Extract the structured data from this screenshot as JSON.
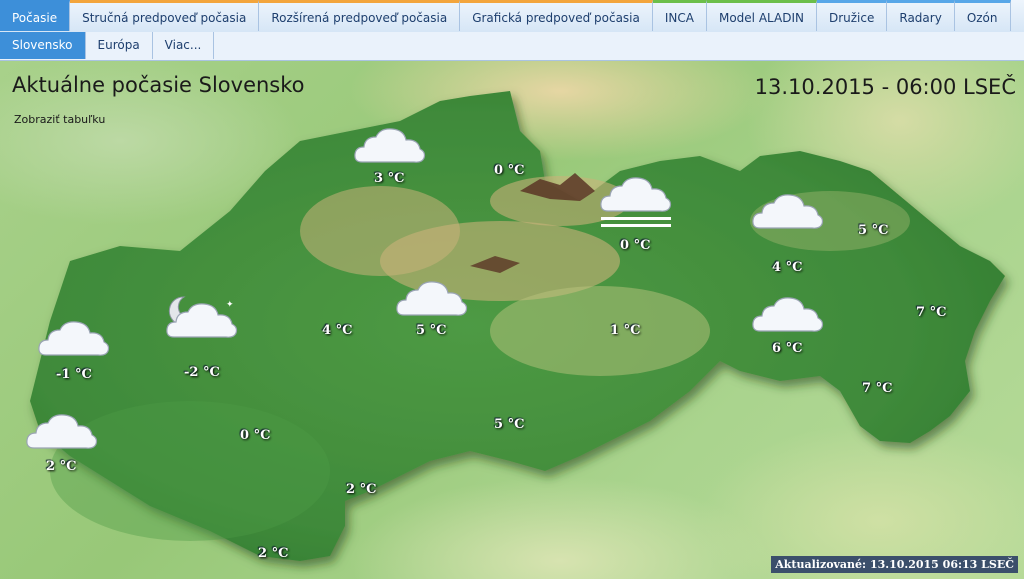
{
  "nav": {
    "tabs": [
      {
        "label": "Počasie"
      },
      {
        "label": "Stručná predpoveď počasia"
      },
      {
        "label": "Rozšírená predpoveď počasia"
      },
      {
        "label": "Grafická predpoveď počasia"
      },
      {
        "label": "INCA"
      },
      {
        "label": "Model ALADIN"
      },
      {
        "label": "Družice"
      },
      {
        "label": "Radary"
      },
      {
        "label": "Ozón"
      }
    ],
    "subtabs": [
      {
        "label": "Slovensko"
      },
      {
        "label": "Európa"
      },
      {
        "label": "Viac..."
      }
    ]
  },
  "map": {
    "title": "Aktuálne počasie Slovensko",
    "show_table": "Zobraziť tabuľku",
    "datetime": "13.10.2015 - 06:00 LSEČ",
    "updated": "Aktualizované: 13.10.2015 06:13 LSEČ",
    "colors": {
      "land": "#3f8a3a",
      "mountain": "#c9b37a",
      "peak": "#5a3626",
      "background": "#a8d18a"
    },
    "stations": [
      {
        "temp": "3 °C",
        "icon": "cloud-icon"
      },
      {
        "temp": "0 °C",
        "icon": ""
      },
      {
        "temp": "0 °C",
        "icon": "fog-icon"
      },
      {
        "temp": "5 °C",
        "icon": ""
      },
      {
        "temp": "4 °C",
        "icon": "cloud-icon"
      },
      {
        "temp": "7 °C",
        "icon": ""
      },
      {
        "temp": "6 °C",
        "icon": "cloud-icon"
      },
      {
        "temp": "7 °C",
        "icon": ""
      },
      {
        "temp": "1 °C",
        "icon": ""
      },
      {
        "temp": "5 °C",
        "icon": "cloud-icon"
      },
      {
        "temp": "4 °C",
        "icon": ""
      },
      {
        "temp": "-2 °C",
        "icon": "partly-cloudy-night-icon"
      },
      {
        "temp": "-1 °C",
        "icon": "cloud-icon"
      },
      {
        "temp": "2 °C",
        "icon": "cloud-icon"
      },
      {
        "temp": "0 °C",
        "icon": ""
      },
      {
        "temp": "5 °C",
        "icon": ""
      },
      {
        "temp": "2 °C",
        "icon": ""
      },
      {
        "temp": "2 °C",
        "icon": ""
      }
    ]
  }
}
